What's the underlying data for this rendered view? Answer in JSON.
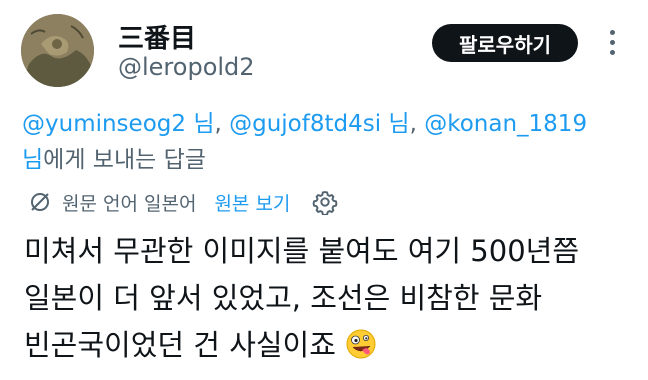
{
  "author": {
    "display_name": "三番目",
    "handle": "@leropold2",
    "follow_label": "팔로우하기"
  },
  "reply_to": {
    "mentions": [
      "@yuminseog2",
      "@gujof8td4si",
      "@konan_1819"
    ],
    "suffix_nim": "님",
    "separator": ",",
    "tail": "에게 보내는 답글"
  },
  "translation": {
    "icon": "translate-slash-icon",
    "original_language": "원문 언어 일본어",
    "show_original_label": "원본 보기",
    "settings_icon": "gear-icon"
  },
  "tweet": {
    "line1": "미쳐서 무관한 이미지를 붙여도 여기 500년쯤",
    "line2": "일본이 더 앞서 있었고, 조선은 비참한 문화",
    "line3": "빈곤국이었던 건 사실이죠",
    "emoji": "zany-face-emoji"
  },
  "colors": {
    "accent": "#1d9bf0",
    "text": "#0f1419",
    "secondary": "#536471",
    "follow_bg": "#0f1419"
  }
}
